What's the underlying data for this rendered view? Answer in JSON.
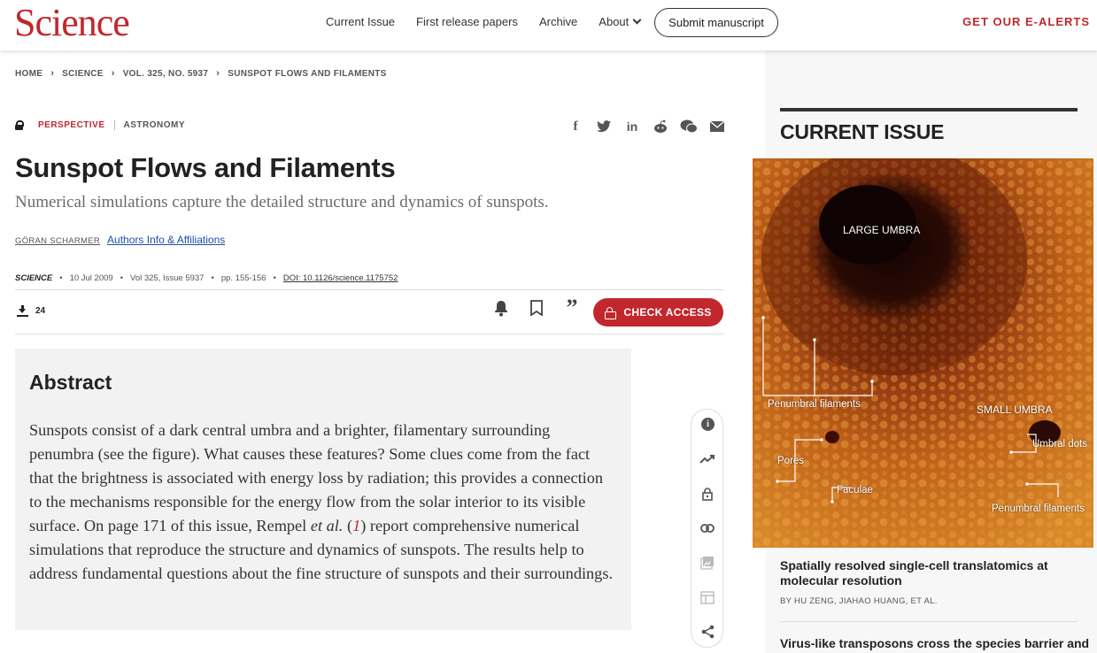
{
  "header": {
    "logo": "Science",
    "nav": [
      "Current Issue",
      "First release papers",
      "Archive",
      "About"
    ],
    "submit": "Submit manuscript",
    "alerts": "GET OUR E-ALERTS"
  },
  "breadcrumb": [
    "HOME",
    "SCIENCE",
    "VOL. 325, NO. 5937",
    "SUNSPOT FLOWS AND FILAMENTS"
  ],
  "article": {
    "type": "PERSPECTIVE",
    "section": "ASTRONOMY",
    "title": "Sunspot Flows and Filaments",
    "subtitle": "Numerical simulations capture the detailed structure and dynamics of sunspots.",
    "author": "GÖRAN SCHARMER",
    "affil_link": "Authors Info & Affiliations",
    "journal": "SCIENCE",
    "date": "10 Jul 2009",
    "volume": "Vol 325, Issue 5937",
    "pages": "pp. 155-156",
    "doi": "DOI: 10.1126/science.1175752",
    "downloads": "24",
    "check_access": "CHECK ACCESS"
  },
  "abstract": {
    "heading": "Abstract",
    "text_before": "Sunspots consist of a dark central umbra and a brighter, filamentary surrounding penumbra (see the figure). What causes these features? Some clues come from the fact that the brightness is associated with energy loss by radiation; this provides a connection to the mechanisms responsible for the energy flow from the solar interior to its visible surface. On page 171 of this issue, Rempel ",
    "et_al": "et al.",
    "ref_open": " (",
    "ref": "1",
    "text_after": ") report comprehensive numerical simulations that reproduce the structure and dynamics of sunspots. The results help to address fundamental questions about the fine structure of sunspots and their surroundings."
  },
  "share_icons": [
    "facebook-icon",
    "twitter-icon",
    "linkedin-icon",
    "reddit-icon",
    "wechat-icon",
    "email-icon"
  ],
  "sidebar": {
    "heading": "CURRENT ISSUE",
    "cover_labels": {
      "large_umbra": "LARGE UMBRA",
      "penumbral1": "Penumbral filaments",
      "small_umbra": "SMALL UMBRA",
      "umbral_dots": "Umbral dots",
      "pores": "Pores",
      "faculae": "Faculae",
      "penumbral2": "Penumbral filaments"
    },
    "news1_title": "Spatially resolved single-cell translatomics at molecular resolution",
    "news1_by": "BY HU ZENG, JIAHAO HUANG, ET AL.",
    "news2_title": "Virus-like transposons cross the species barrier and"
  },
  "colors": {
    "brand": "#c1272d"
  }
}
